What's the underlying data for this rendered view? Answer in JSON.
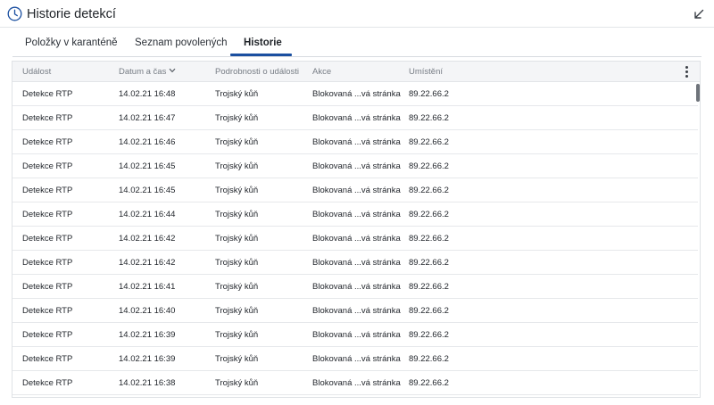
{
  "window": {
    "title": "Historie detekcí",
    "icon": "clock-icon",
    "collapse_icon": "arrow-down-left-icon"
  },
  "tabs": [
    {
      "label": "Položky v karanténě",
      "active": false
    },
    {
      "label": "Seznam povolených",
      "active": false
    },
    {
      "label": "Historie",
      "active": true
    }
  ],
  "colors": {
    "accent": "#1a4fa0",
    "header_bg": "#f4f5f7",
    "header_text": "#777d85",
    "border": "#dfe2e6"
  },
  "table": {
    "columns": [
      "Událost",
      "Datum a čas",
      "Podrobnosti o události",
      "Akce",
      "Umístění"
    ],
    "sorted_column": "Datum a čas",
    "sort_direction": "descending",
    "menu_icon": "more-vertical-icon",
    "rows": [
      [
        "Detekce RTP",
        "14.02.21 16:48",
        "Trojský kůň",
        "Blokovaná ...vá stránka",
        "89.22.66.2"
      ],
      [
        "Detekce RTP",
        "14.02.21 16:47",
        "Trojský kůň",
        "Blokovaná ...vá stránka",
        "89.22.66.2"
      ],
      [
        "Detekce RTP",
        "14.02.21 16:46",
        "Trojský kůň",
        "Blokovaná ...vá stránka",
        "89.22.66.2"
      ],
      [
        "Detekce RTP",
        "14.02.21 16:45",
        "Trojský kůň",
        "Blokovaná ...vá stránka",
        "89.22.66.2"
      ],
      [
        "Detekce RTP",
        "14.02.21 16:45",
        "Trojský kůň",
        "Blokovaná ...vá stránka",
        "89.22.66.2"
      ],
      [
        "Detekce RTP",
        "14.02.21 16:44",
        "Trojský kůň",
        "Blokovaná ...vá stránka",
        "89.22.66.2"
      ],
      [
        "Detekce RTP",
        "14.02.21 16:42",
        "Trojský kůň",
        "Blokovaná ...vá stránka",
        "89.22.66.2"
      ],
      [
        "Detekce RTP",
        "14.02.21 16:42",
        "Trojský kůň",
        "Blokovaná ...vá stránka",
        "89.22.66.2"
      ],
      [
        "Detekce RTP",
        "14.02.21 16:41",
        "Trojský kůň",
        "Blokovaná ...vá stránka",
        "89.22.66.2"
      ],
      [
        "Detekce RTP",
        "14.02.21 16:40",
        "Trojský kůň",
        "Blokovaná ...vá stránka",
        "89.22.66.2"
      ],
      [
        "Detekce RTP",
        "14.02.21 16:39",
        "Trojský kůň",
        "Blokovaná ...vá stránka",
        "89.22.66.2"
      ],
      [
        "Detekce RTP",
        "14.02.21 16:39",
        "Trojský kůň",
        "Blokovaná ...vá stránka",
        "89.22.66.2"
      ],
      [
        "Detekce RTP",
        "14.02.21 16:38",
        "Trojský kůň",
        "Blokovaná ...vá stránka",
        "89.22.66.2"
      ]
    ]
  }
}
